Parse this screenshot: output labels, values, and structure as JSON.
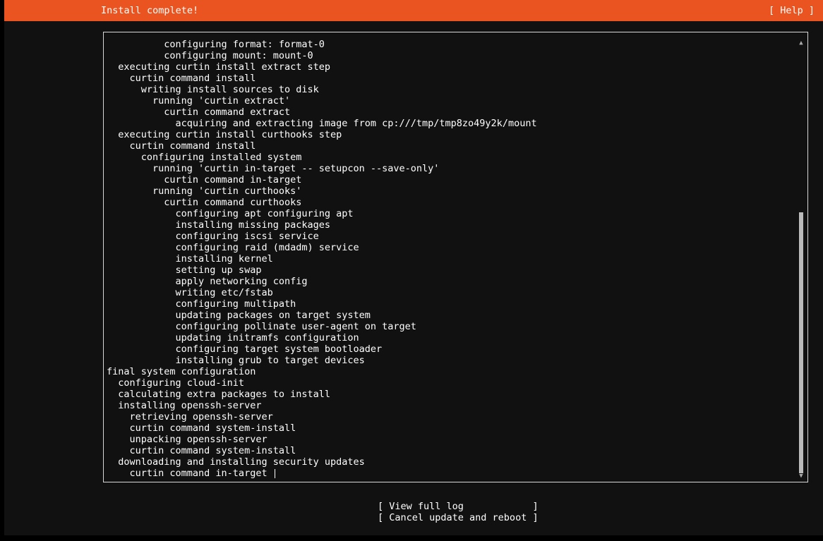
{
  "header": {
    "title": "Install complete!",
    "help_label": "[ Help ]",
    "accent_color": "#e95420"
  },
  "log": {
    "lines": [
      "          configuring format: format-0",
      "          configuring mount: mount-0",
      "  executing curtin install extract step",
      "    curtin command install",
      "      writing install sources to disk",
      "        running 'curtin extract'",
      "          curtin command extract",
      "            acquiring and extracting image from cp:///tmp/tmp8zo49y2k/mount",
      "  executing curtin install curthooks step",
      "    curtin command install",
      "      configuring installed system",
      "        running 'curtin in-target -- setupcon --save-only'",
      "          curtin command in-target",
      "        running 'curtin curthooks'",
      "          curtin command curthooks",
      "            configuring apt configuring apt",
      "            installing missing packages",
      "            configuring iscsi service",
      "            configuring raid (mdadm) service",
      "            installing kernel",
      "            setting up swap",
      "            apply networking config",
      "            writing etc/fstab",
      "            configuring multipath",
      "            updating packages on target system",
      "            configuring pollinate user-agent on target",
      "            updating initramfs configuration",
      "            configuring target system bootloader",
      "            installing grub to target devices",
      "final system configuration",
      "  configuring cloud-init",
      "  calculating extra packages to install",
      "  installing openssh-server",
      "    retrieving openssh-server",
      "    curtin command system-install",
      "    unpacking openssh-server",
      "    curtin command system-install",
      "  downloading and installing security updates",
      "    curtin command in-target "
    ],
    "scroll_up_icon": "▲",
    "scroll_down_icon": "▼"
  },
  "actions": {
    "view_full_log": "[ View full log            ]",
    "cancel_update_reboot": "[ Cancel update and reboot ]"
  }
}
